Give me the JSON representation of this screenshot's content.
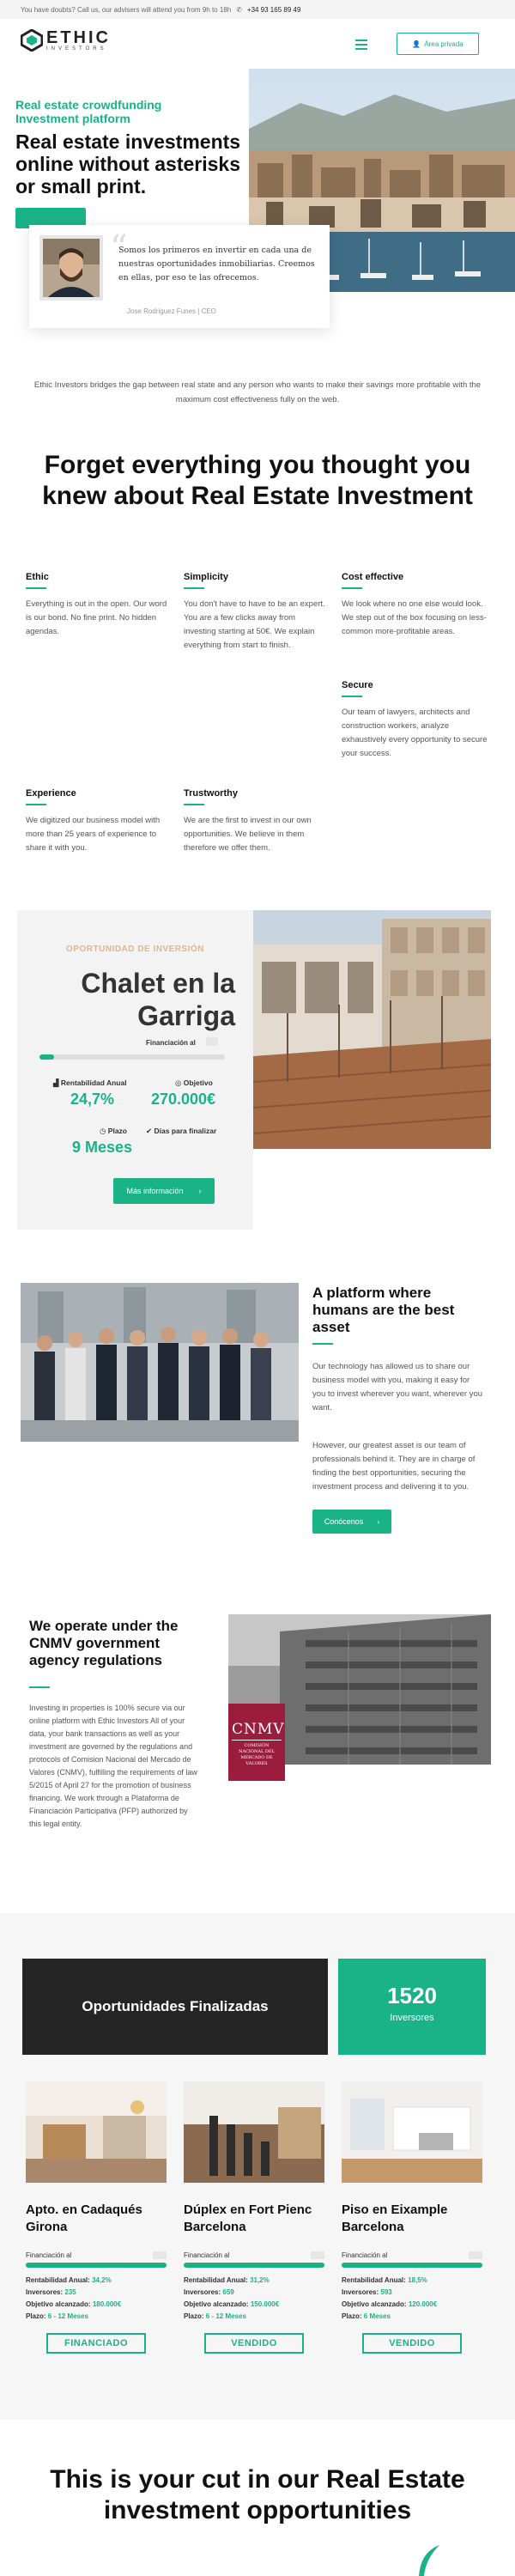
{
  "topbar": {
    "message": "You have doubts? Call us, our advisers will attend you from 9h to 18h",
    "phone": "+34 93 165 89 49"
  },
  "header": {
    "logo_big": "ETHIC",
    "logo_small": "INVESTORS",
    "private_area_label": "Área privada",
    "brand_color": "#19b387"
  },
  "hero": {
    "tagline": "Real estate crowdfunding Investment platform",
    "title": "Real estate investments online without asterisks or small print.",
    "quote": "Somos los primeros en invertir en cada una de nuestras oportunidades inmobiliarias. Creemos en ellas, por eso te las ofrecemos.",
    "quote_author": "Jose Rodriguez Funes | CEO"
  },
  "intro": "Ethic Investors bridges the gap between real state and any person who wants to make their savings more profitable with the maximum cost effectiveness fully on the web.",
  "forget": {
    "title": "Forget everything you thought you knew about Real Estate Investment",
    "features": [
      {
        "title": "Ethic",
        "text": "Everything is out in the open. Our word is our bond. No fine print. No hidden agendas."
      },
      {
        "title": "Simplicity",
        "text": "You don't have to have to be an expert. You are a few clicks away from investing starting at 50€. We explain everything from start to finish."
      },
      {
        "title": "Cost effective",
        "text": "We look where no one else would look. We step out of the box focusing on less-common more-profitable areas."
      },
      {
        "title": "Secure",
        "text": "Our team of lawyers, architects and construction workers, analyze exhaustively every opportunity to secure your success."
      },
      {
        "title": "Experience",
        "text": "We digitized our business model with more than 25 years of experience to share it with you."
      },
      {
        "title": "Trustworthy",
        "text": "We are the first to invest in our own opportunities. We believe in them therefore we offer them."
      }
    ]
  },
  "opportunity": {
    "label": "OPORTUNIDAD DE INVERSIÓN",
    "title": "Chalet en la Garriga",
    "financing_label": "Financiación al",
    "financing_pct": "",
    "financing_fraction": 0.08,
    "rent_label": "Rentabilidad Anual",
    "rent_value": "24,7%",
    "objective_label": "Objetivo",
    "objective_value": "270.000€",
    "term_label": "Plazo",
    "term_value": "9 Meses",
    "days_label": "Días para finalizar",
    "more_info_label": "Más información"
  },
  "platform": {
    "title": "A platform where humans are the best asset",
    "p1": "Our technology has allowed us to share our business model with you, making it easy for you to invest wherever you want, wherever you want.",
    "p2": "However, our greatest asset is our team of professionals behind it. They are in charge of finding the best opportunities, securing the investment process and delivering it to you.",
    "button_label": "Conócenos"
  },
  "cnmv": {
    "title": "We operate under the CNMV government agency regulations",
    "text": "Investing in properties is 100% secure via our online platform with Ethic Investors All of your data, your bank transactions as well as your investment are governed by the regulations and protocols of Comision Nacional del Mercado de Valores (CNMV), fulfilling the requirements of law 5/2015 of April 27 for the promotion of business financing. We work through a Plataforma de Financiación Participativa (PFP) authorized by this legal entity.",
    "logo_big": "CNMV",
    "logo_small": "COMISIÓN NACIONAL DEL MERCADO DE VALORES"
  },
  "finished": {
    "title": "Oportunidades Finalizadas",
    "count": "1520",
    "count_label": "Inversores",
    "properties": [
      {
        "title": "Apto. en Cadaqués Girona",
        "fin_label": "Financiación al",
        "fin_fraction": 1.0,
        "rent": "34,2%",
        "investors": "235",
        "objective": "180.000€",
        "term": "6 - 12 Meses",
        "status": "FINANCIADO"
      },
      {
        "title": "Dúplex en Fort Pienc Barcelona",
        "fin_label": "Financiación al",
        "fin_fraction": 1.0,
        "rent": "31,2%",
        "investors": "659",
        "objective": "150.000€",
        "term": "6 - 12 Meses",
        "status": "VENDIDO"
      },
      {
        "title": "Piso en Eixample Barcelona",
        "fin_label": "Financiación al",
        "fin_fraction": 1.0,
        "rent": "18,5%",
        "investors": "593",
        "objective": "120.000€",
        "term": "6 Meses",
        "status": "VENDIDO"
      }
    ],
    "labels": {
      "rent": "Rentabilidad Anual:",
      "investors": "Inversores:",
      "objective": "Objetivo alcanzado:",
      "term": "Plazo:"
    }
  },
  "cut": {
    "title": "This is your cut in our Real Estate investment opportunities"
  }
}
